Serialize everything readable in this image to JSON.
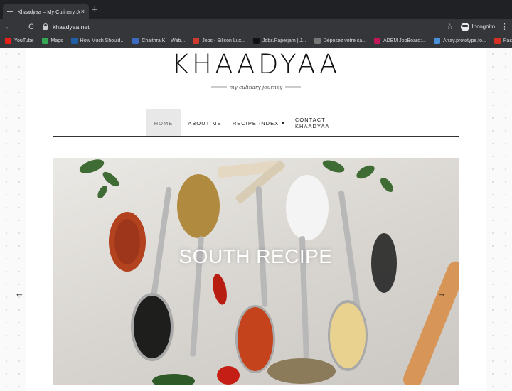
{
  "browser": {
    "tab": {
      "title": "Khaadyaa – My Culinary Journey",
      "close": "×"
    },
    "new_tab": "+",
    "nav": {
      "back": "←",
      "forward": "→",
      "reload": "C"
    },
    "url": "khaadyaa.net",
    "star": "☆",
    "incognito_label": "Incognito",
    "menu": "⋮",
    "bookmarks": [
      {
        "label": "YouTube",
        "icon": "youtube-icon",
        "color": "#e62117"
      },
      {
        "label": "Maps",
        "icon": "maps-icon",
        "color": "#34a853"
      },
      {
        "label": "How Much Should...",
        "icon": "fx-icon",
        "color": "#1f5fa8"
      },
      {
        "label": "Chaithra K – Web...",
        "icon": "bookmark-icon",
        "color": "#3d6bbf"
      },
      {
        "label": "Jobs - Silicon Lux...",
        "icon": "jobs-icon",
        "color": "#d03b2e"
      },
      {
        "label": "Jobs.Paperjam | J...",
        "icon": "paperjam-icon",
        "color": "#111111"
      },
      {
        "label": "Déposez votre ca...",
        "icon": "doc-icon",
        "color": "#777777"
      },
      {
        "label": "ADEM JobBoard:...",
        "icon": "adem-icon",
        "color": "#c2185b"
      },
      {
        "label": "Array.prototype.fo...",
        "icon": "mdn-icon",
        "color": "#4a90d9"
      },
      {
        "label": "Password Reset –...",
        "icon": "gmail-icon",
        "color": "#d93025"
      }
    ]
  },
  "site": {
    "logo": "KHAADYAA",
    "tagline": "my culinary journey",
    "nav": [
      {
        "label": "HOME",
        "active": true
      },
      {
        "label": "ABOUT ME",
        "active": false
      },
      {
        "label": "RECIPE INDEX",
        "active": false,
        "dropdown": true
      },
      {
        "label": "CONTACT KHAADYAA",
        "active": false
      }
    ],
    "slider": {
      "title": "SOUTH RECIPE",
      "prev": "←",
      "next": "→"
    }
  }
}
